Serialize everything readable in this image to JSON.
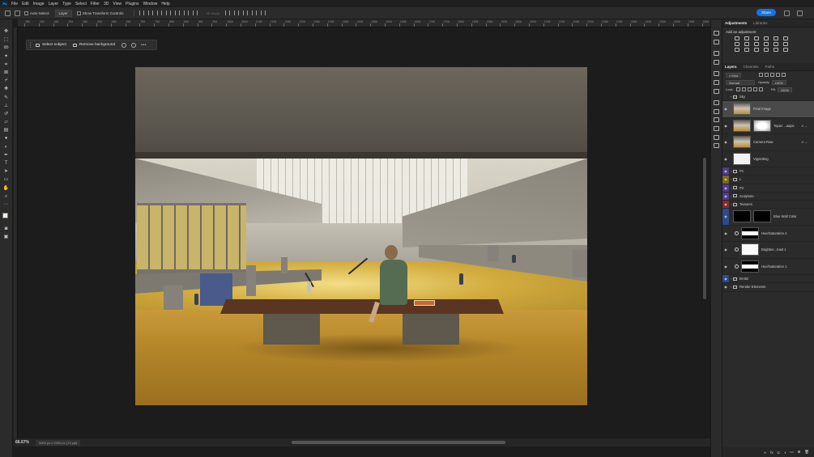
{
  "app": {
    "logo": "Ps"
  },
  "menu": [
    "File",
    "Edit",
    "Image",
    "Layer",
    "Type",
    "Select",
    "Filter",
    "3D",
    "View",
    "Plugins",
    "Window",
    "Help"
  ],
  "options_bar": {
    "auto_select_label": "Auto-Select:",
    "auto_select_value": "Layer",
    "transform_controls_label": "Show Transform Controls",
    "mode_3d_label": "3D Mode:",
    "share_label": "Share"
  },
  "tools": [
    "move",
    "marquee",
    "lasso",
    "magic-wand",
    "crop",
    "frame",
    "eyedropper",
    "healing",
    "brush",
    "stamp",
    "history-brush",
    "eraser",
    "gradient",
    "blur",
    "dodge",
    "pen",
    "type",
    "path-select",
    "rectangle",
    "hand",
    "zoom",
    "more"
  ],
  "ruler": [
    "300",
    "350",
    "400",
    "450",
    "500",
    "550",
    "600",
    "650",
    "700",
    "750",
    "800",
    "850",
    "900",
    "950",
    "1000",
    "1050",
    "1100",
    "1150",
    "1200",
    "1250",
    "1300",
    "1350",
    "1400",
    "1450",
    "1500",
    "1550",
    "1600",
    "1650",
    "1700",
    "1750",
    "1800",
    "1850",
    "1900",
    "1950",
    "2000",
    "2050",
    "2100",
    "2150",
    "2200",
    "2250",
    "2300",
    "2350",
    "2400",
    "2450",
    "2500",
    "2550",
    "2600",
    "2650"
  ],
  "taskbar": {
    "select_subject": "Select subject",
    "remove_background": "Remove background",
    "more": "•••"
  },
  "status": {
    "zoom": "66.67%",
    "doc_info": "3000 px x 2400 px (72 ppi)"
  },
  "panels": {
    "adjustments_tab": "Adjustments",
    "libraries_tab": "Libraries",
    "add_adjustment": "Add an adjustment",
    "layers_tab": "Layers",
    "channels_tab": "Channels",
    "paths_tab": "Paths",
    "kind_label": "Kind",
    "blend_mode": "Normal",
    "opacity_label": "Opacity:",
    "opacity_value": "100%",
    "lock_label": "Lock:",
    "fill_label": "Fill:",
    "fill_value": "100%"
  },
  "layers": [
    {
      "name": "Sky",
      "type": "group",
      "eye": false,
      "tall": false
    },
    {
      "name": "Final Image",
      "type": "image",
      "eye": true,
      "tall": true,
      "selected": true
    },
    {
      "name": "Topaz ...aapic",
      "type": "smart",
      "eye": true,
      "tall": true
    },
    {
      "name": "Camera Raw",
      "type": "image",
      "eye": true,
      "tall": true
    },
    {
      "name": "Vignetting",
      "type": "white",
      "eye": true,
      "tall": true
    },
    {
      "name": "P1",
      "type": "group",
      "eye": true,
      "tall": false,
      "color": "#4f3d8c"
    },
    {
      "name": "L",
      "type": "group",
      "eye": true,
      "tall": false,
      "color": "#7a6a1a"
    },
    {
      "name": "P2",
      "type": "group",
      "eye": true,
      "tall": false,
      "color": "#4f3d8c"
    },
    {
      "name": "Sculpture",
      "type": "group",
      "eye": true,
      "tall": false,
      "color": "#4f3d8c"
    },
    {
      "name": "Textures",
      "type": "group",
      "eye": true,
      "tall": false,
      "color": "#8a2a2a"
    },
    {
      "name": "Blue Wall Color",
      "type": "mask",
      "eye": true,
      "tall": true,
      "color": "#2c4a8c"
    },
    {
      "name": "Hue/Saturation 4",
      "type": "adjustment",
      "eye": true,
      "tall": true
    },
    {
      "name": "Brightne...trast 1",
      "type": "adjustment-white",
      "eye": true,
      "tall": true
    },
    {
      "name": "Hue/Saturation 1",
      "type": "adjustment",
      "eye": true,
      "tall": true
    },
    {
      "name": "BASE",
      "type": "group",
      "eye": true,
      "tall": false,
      "color": "#2c4a8c"
    },
    {
      "name": "Render Elements",
      "type": "group",
      "eye": true,
      "tall": false
    }
  ],
  "layers_bottom": [
    "link",
    "fx",
    "mask",
    "adjust",
    "folder",
    "new",
    "trash"
  ],
  "colors": {
    "accent": "#1473e6",
    "panel": "#2b2b2b",
    "canvas": "#1c1c1c"
  }
}
